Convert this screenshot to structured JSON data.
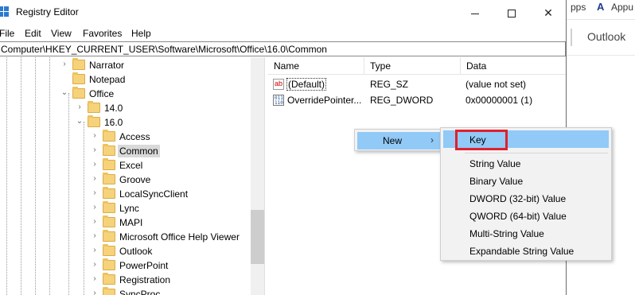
{
  "background_app": {
    "apps_text": "pps",
    "appu_text": "Appu",
    "letter": "A",
    "outlook_text": "Outlook"
  },
  "window": {
    "title": "Registry Editor",
    "controls": {
      "minimize": "",
      "maximize": "",
      "close": "✕"
    }
  },
  "menubar": [
    "File",
    "Edit",
    "View",
    "Favorites",
    "Help"
  ],
  "address": "Computer\\HKEY_CURRENT_USER\\Software\\Microsoft\\Office\\16.0\\Common",
  "tree": [
    {
      "label": "Narrator",
      "expander": "›"
    },
    {
      "label": "Notepad",
      "expander": ""
    },
    {
      "label": "Office",
      "expander": "⌄"
    },
    {
      "label": "14.0",
      "expander": "›"
    },
    {
      "label": "16.0",
      "expander": "⌄"
    },
    {
      "label": "Access",
      "expander": "›"
    },
    {
      "label": "Common",
      "expander": "›",
      "selected": true
    },
    {
      "label": "Excel",
      "expander": "›"
    },
    {
      "label": "Groove",
      "expander": "›"
    },
    {
      "label": "LocalSyncClient",
      "expander": "›"
    },
    {
      "label": "Lync",
      "expander": "›"
    },
    {
      "label": "MAPI",
      "expander": "›"
    },
    {
      "label": "Microsoft Office Help Viewer",
      "expander": "›"
    },
    {
      "label": "Outlook",
      "expander": "›"
    },
    {
      "label": "PowerPoint",
      "expander": "›"
    },
    {
      "label": "Registration",
      "expander": "›"
    },
    {
      "label": "SyncProc",
      "expander": "›"
    }
  ],
  "list": {
    "columns": [
      "Name",
      "Type",
      "Data"
    ],
    "rows": [
      {
        "icon": "ab",
        "name": "(Default)",
        "type": "REG_SZ",
        "data": "(value not set)"
      },
      {
        "icon": "011\n110",
        "name": "OverridePointer...",
        "type": "REG_DWORD",
        "data": "0x00000001 (1)"
      }
    ]
  },
  "context_menu": {
    "new_label": "New",
    "arrow": "›"
  },
  "submenu": {
    "key": "Key",
    "items": [
      "String Value",
      "Binary Value",
      "DWORD (32-bit) Value",
      "QWORD (64-bit) Value",
      "Multi-String Value",
      "Expandable String Value"
    ]
  },
  "colors": {
    "highlight": "#91c9f7",
    "callout": "#e0202c",
    "folder": "#f6d27a",
    "selection": "#d9d9d9"
  }
}
